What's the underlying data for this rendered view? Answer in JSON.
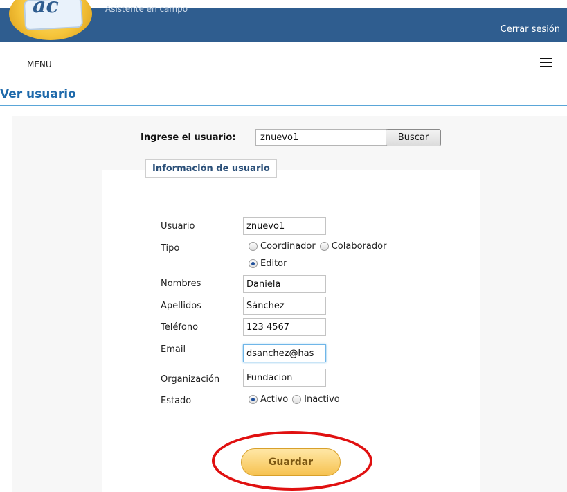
{
  "header": {
    "logo_text": "ac",
    "tagline": "Asistente en campo",
    "logout_label": "Cerrar sesión"
  },
  "menu": {
    "label": "MENU",
    "hamburger_icon": "hamburger-menu-icon"
  },
  "page": {
    "title": "Ver usuario"
  },
  "search": {
    "label": "Ingrese el usuario:",
    "value": "znuevo1",
    "button_label": "Buscar"
  },
  "form": {
    "legend": "Información de usuario",
    "usuario_label": "Usuario",
    "usuario_value": "znuevo1",
    "tipo_label": "Tipo",
    "tipo_options": [
      "Coordinador",
      "Colaborador",
      "Editor"
    ],
    "tipo_selected": "Editor",
    "nombres_label": "Nombres",
    "nombres_value": "Daniela",
    "apellidos_label": "Apellidos",
    "apellidos_value": "Sánchez",
    "telefono_label": "Teléfono",
    "telefono_value": "123 4567",
    "email_label": "Email",
    "email_value": "dsanchez@has",
    "organizacion_label": "Organización",
    "organizacion_value": "Fundacion",
    "estado_label": "Estado",
    "estado_options": [
      "Activo",
      "Inactivo"
    ],
    "estado_selected": "Activo",
    "save_label": "Guardar"
  },
  "colors": {
    "header_bg": "#2f5d8f",
    "title": "#1f6aab",
    "annotation": "#e01010",
    "save_button": "#f6c250"
  }
}
